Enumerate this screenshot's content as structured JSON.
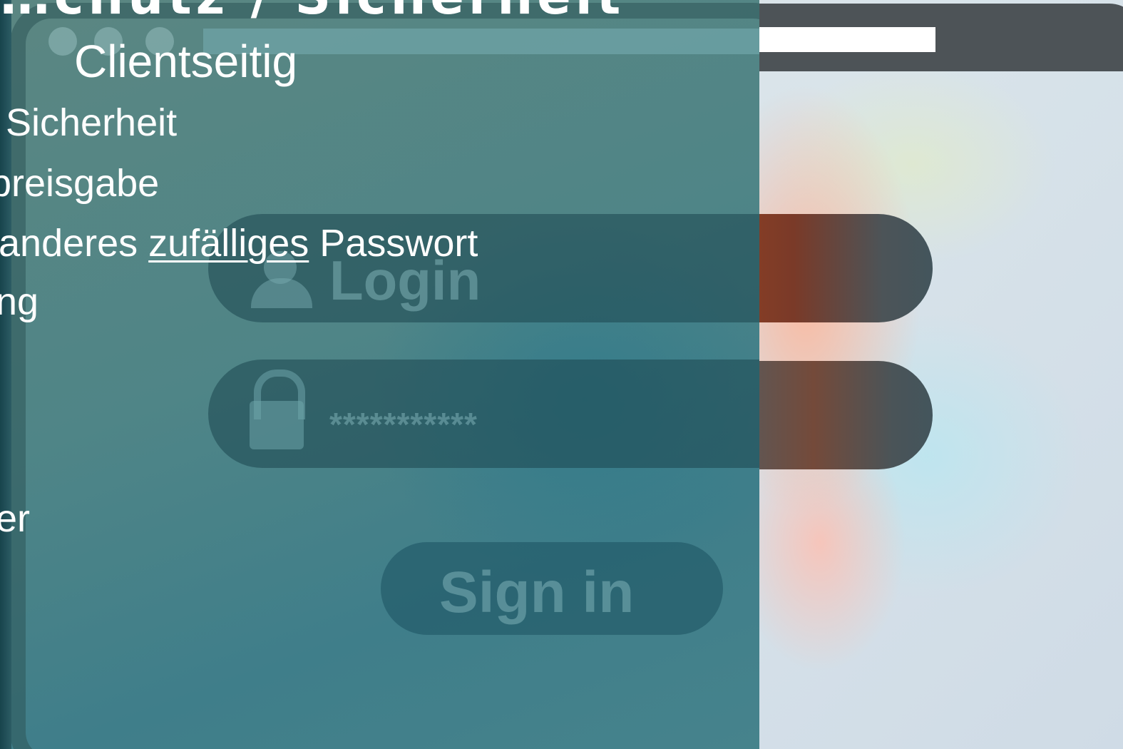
{
  "slide": {
    "title_fragment": "…chutz / Sicherheit",
    "subheading": "Clientseitig",
    "lines": [
      "Sicherheit",
      "preisgabe",
      {
        "prefix": "anderes ",
        "underlined": "zufälliges",
        "suffix": " Passwort"
      },
      "ng",
      "er"
    ]
  },
  "background_illustration": {
    "login_label": "Login",
    "password_mask": "***********",
    "signin_label": "Sign in"
  },
  "colors": {
    "panel_tint": "#4f8587",
    "text": "#ffffff",
    "browser_bar": "#4d5357"
  }
}
